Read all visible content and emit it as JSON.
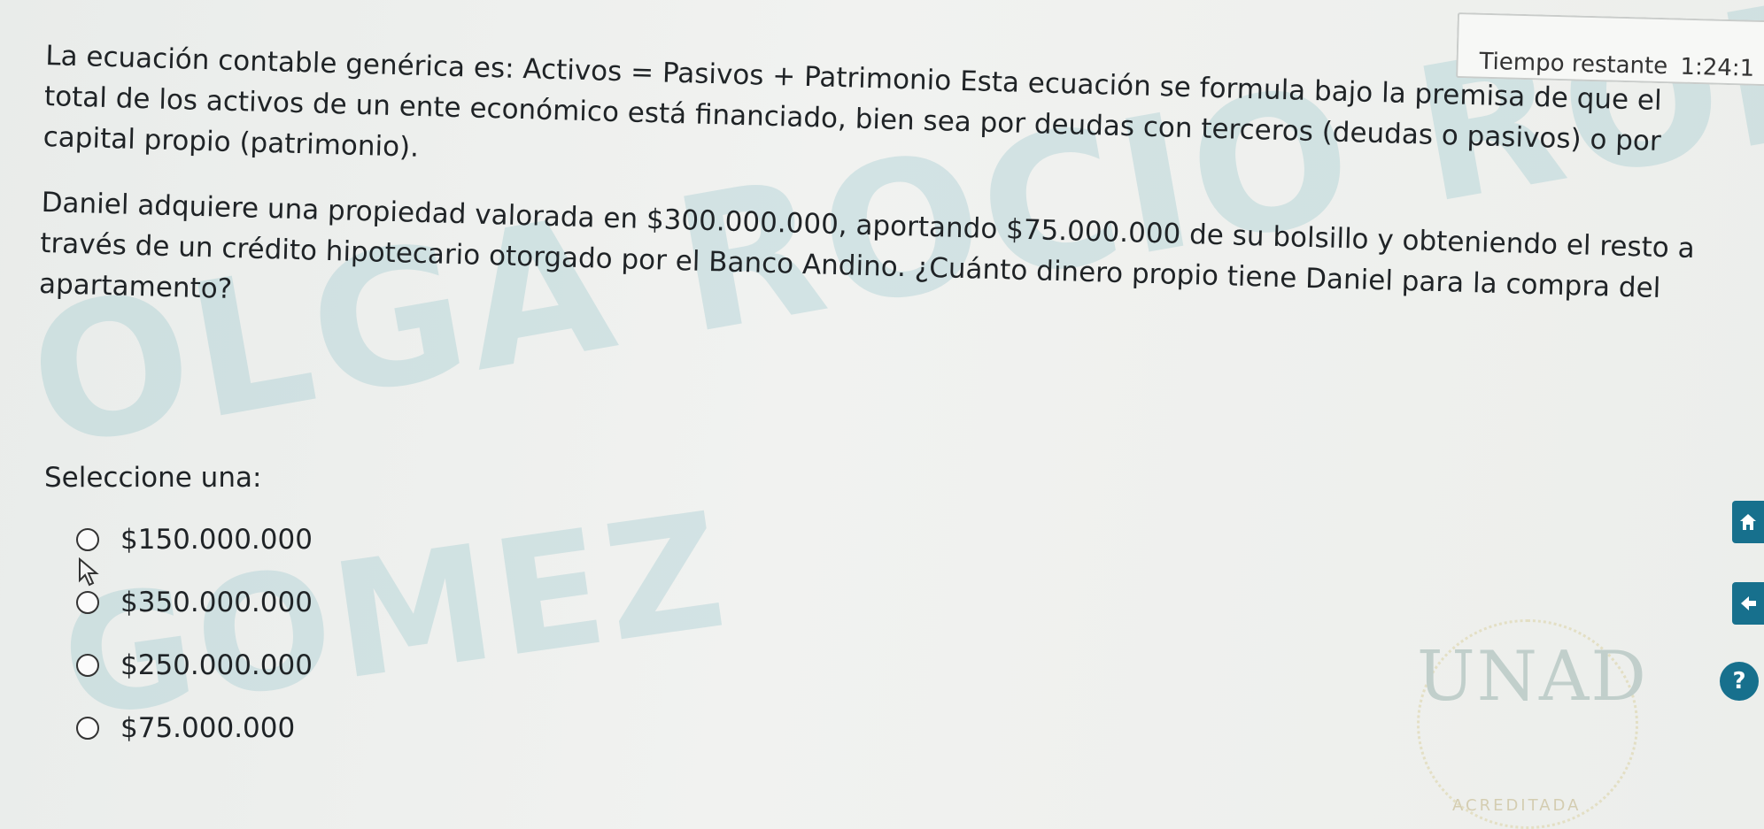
{
  "timer": {
    "label": "Tiempo restante",
    "value": "1:24:1"
  },
  "question": {
    "statement": "La ecuación contable genérica es: Activos = Pasivos + Patrimonio Esta ecuación se formula bajo la premisa de que el total de los activos de un ente económico está financiado, bien sea por deudas con terceros (deudas o pasivos) o por capital propio (patrimonio).",
    "problem": "Daniel adquiere una propiedad valorada en $300.000.000, aportando $75.000.000 de su bolsillo y obteniendo el resto a través de un crédito hipotecario otorgado por el Banco Andino. ¿Cuánto dinero propio tiene Daniel para la compra del apartamento?"
  },
  "select_label": "Seleccione una:",
  "options": [
    {
      "label": "$150.000.000",
      "selected": false
    },
    {
      "label": "$350.000.000",
      "selected": false
    },
    {
      "label": "$250.000.000",
      "selected": false
    },
    {
      "label": "$75.000.000",
      "selected": false
    }
  ],
  "watermark": {
    "line1": "OLGA ROCIO RODRIGUEZ",
    "line2": "GOMEZ"
  },
  "logo": {
    "name": "UNAD",
    "subtitle": "ACREDITADA"
  },
  "side_icons": [
    "home-icon",
    "back-arrow-icon",
    "help-icon"
  ]
}
